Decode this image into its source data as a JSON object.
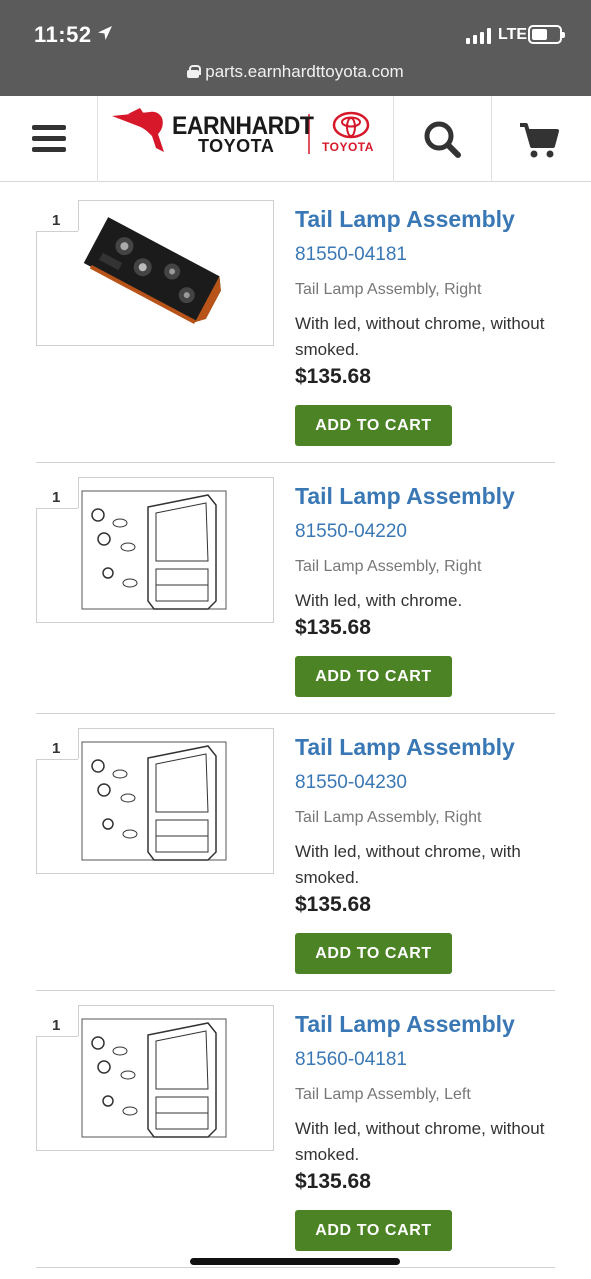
{
  "status_bar": {
    "time": "11:52",
    "network": "LTE",
    "url": "parts.earnhardttoyota.com"
  },
  "header": {
    "logo_text_line1": "EARNHARDT",
    "logo_text_line2": "TOYOTA",
    "toyota_wordmark": "TOYOTA",
    "brand_red": "#d7182a",
    "icons": {
      "menu": "hamburger-menu-icon",
      "search": "search-icon",
      "cart": "cart-icon"
    }
  },
  "accent_color": "#3a78b5",
  "button_color": "#4b8325",
  "products": [
    {
      "qty": "1",
      "name": "Tail Lamp Assembly",
      "part_number": "81550-04181",
      "description": "Tail Lamp Assembly, Right",
      "note": "With led, without chrome, without smoked.",
      "price": "$135.68",
      "button": "ADD TO CART",
      "image": "photo"
    },
    {
      "qty": "1",
      "name": "Tail Lamp Assembly",
      "part_number": "81550-04220",
      "description": "Tail Lamp Assembly, Right",
      "note": "With led, with chrome.",
      "price": "$135.68",
      "button": "ADD TO CART",
      "image": "diagram"
    },
    {
      "qty": "1",
      "name": "Tail Lamp Assembly",
      "part_number": "81550-04230",
      "description": "Tail Lamp Assembly, Right",
      "note": "With led, without chrome, with smoked.",
      "price": "$135.68",
      "button": "ADD TO CART",
      "image": "diagram"
    },
    {
      "qty": "1",
      "name": "Tail Lamp Assembly",
      "part_number": "81560-04181",
      "description": "Tail Lamp Assembly, Left",
      "note": "With led, without chrome, without smoked.",
      "price": "$135.68",
      "button": "ADD TO CART",
      "image": "diagram"
    }
  ]
}
